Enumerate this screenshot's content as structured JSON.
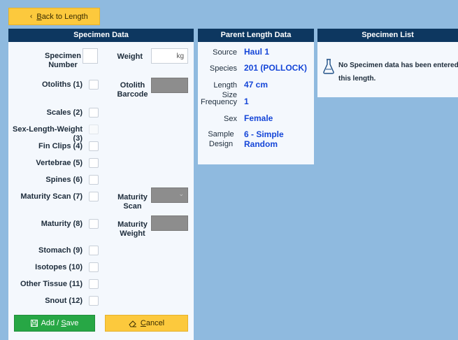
{
  "back_button": {
    "label_prefix": "B",
    "label_rest": "ack to Length",
    "icon": "chevron-left-icon"
  },
  "specimen_panel": {
    "title": "Specimen Data",
    "specimen_number_label": "Specimen Number",
    "weight_label": "Weight",
    "weight_unit": "kg",
    "otolith_barcode_label": "Otolith Barcode",
    "maturity_scan_label": "Maturity Scan",
    "maturity_weight_label": "Maturity Weight",
    "checks": [
      {
        "label": "Otoliths (1)",
        "disabled": false
      },
      {
        "label": "Scales (2)",
        "disabled": false
      },
      {
        "label": "Sex-Length-Weight (3)",
        "disabled": true
      },
      {
        "label": "Fin Clips (4)",
        "disabled": false
      },
      {
        "label": "Vertebrae (5)",
        "disabled": false
      },
      {
        "label": "Spines (6)",
        "disabled": false
      },
      {
        "label": "Maturity Scan (7)",
        "disabled": false
      },
      {
        "label": "Maturity (8)",
        "disabled": false
      },
      {
        "label": "Stomach (9)",
        "disabled": false
      },
      {
        "label": "Isotopes (10)",
        "disabled": false
      },
      {
        "label": "Other Tissue (11)",
        "disabled": false
      },
      {
        "label": "Snout (12)",
        "disabled": false
      }
    ],
    "add_save": {
      "label_prefix": "Add / ",
      "label_ul": "S",
      "label_rest": "ave",
      "icon": "save-icon"
    },
    "cancel": {
      "label_ul": "C",
      "label_rest": "ancel",
      "icon": "eraser-icon"
    }
  },
  "parent_panel": {
    "title": "Parent Length Data",
    "rows": [
      {
        "label": "Source",
        "value": "Haul 1"
      },
      {
        "label": "Species",
        "value": "201 (POLLOCK)"
      },
      {
        "label": "Length Size",
        "value": "47 cm"
      },
      {
        "label": "Frequency",
        "value": "1"
      },
      {
        "label": "Sex",
        "value": "Female"
      },
      {
        "label": "Sample Design",
        "value": "6 - Simple Random"
      }
    ]
  },
  "specimen_list": {
    "title": "Specimen List",
    "message": "No Specimen data has been entered for this length.",
    "icon": "flask-icon"
  },
  "colors": {
    "background": "#8fbadf",
    "header": "#0d3760",
    "accent_yellow": "#fcc93d",
    "accent_green": "#27a745",
    "value_blue": "#1546d8"
  }
}
